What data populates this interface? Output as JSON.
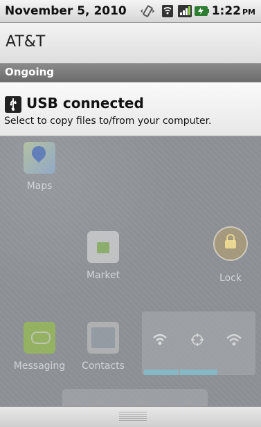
{
  "status_bar": {
    "date": "November 5, 2010",
    "time": "1:22",
    "ampm": "PM",
    "icons": [
      "vibrate-icon",
      "wifi-icon",
      "signal-icon",
      "battery-charging-icon"
    ]
  },
  "carrier": "AT&T",
  "section_header": "Ongoing",
  "notification": {
    "icon": "usb-icon",
    "title": "USB connected",
    "subtitle": "Select to copy files to/from your computer."
  },
  "home": {
    "apps": [
      {
        "label": "Maps",
        "icon": "maps-icon"
      },
      {
        "label": "Market",
        "icon": "market-icon"
      },
      {
        "label": "Lock",
        "icon": "lock-icon"
      },
      {
        "label": "Messaging",
        "icon": "messaging-icon"
      },
      {
        "label": "Contacts",
        "icon": "contacts-icon"
      }
    ]
  },
  "colors": {
    "accent_blue": "#78c8dc",
    "market_green": "#8bc34a",
    "message_green": "#9ccc3a",
    "lock_gold": "#d2aa50"
  }
}
